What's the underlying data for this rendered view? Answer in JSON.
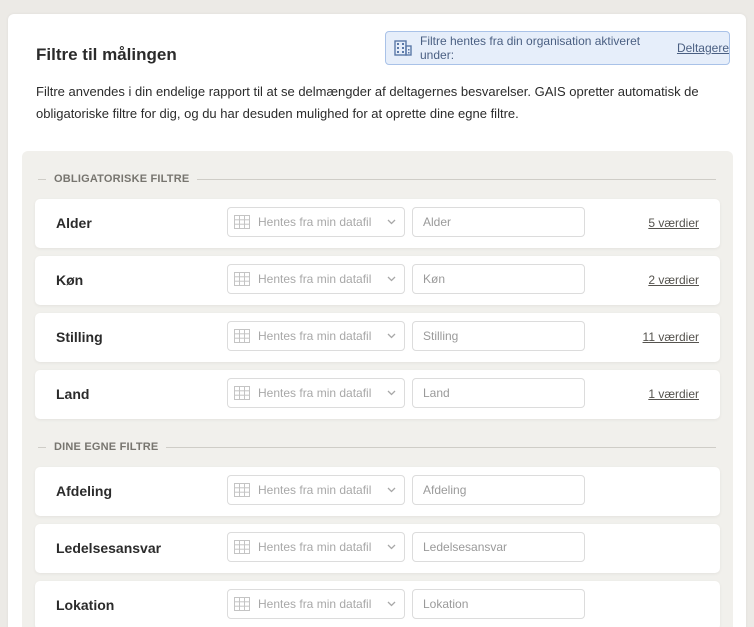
{
  "title": "Filtre til målingen",
  "info": {
    "text": "Filtre hentes fra din organisation aktiveret under:",
    "link": "Deltagere"
  },
  "description": "Filtre anvendes i din endelige rapport til at se delmængder af deltagernes besvarelser. GAIS opretter automatisk de obligatoriske filtre for dig, og du har desuden mulighed for at oprette dine egne filtre.",
  "sections": {
    "mandatory": {
      "header": "OBLIGATORISKE FILTRE",
      "rows": [
        {
          "label": "Alder",
          "select": "Hentes fra min datafil",
          "placeholder": "Alder",
          "values": "5 værdier"
        },
        {
          "label": "Køn",
          "select": "Hentes fra min datafil",
          "placeholder": "Køn",
          "values": "2 værdier"
        },
        {
          "label": "Stilling",
          "select": "Hentes fra min datafil",
          "placeholder": "Stilling",
          "values": "11 værdier"
        },
        {
          "label": "Land",
          "select": "Hentes fra min datafil",
          "placeholder": "Land",
          "values": "1 værdier"
        }
      ]
    },
    "custom": {
      "header": "DINE EGNE FILTRE",
      "rows": [
        {
          "label": "Afdeling",
          "select": "Hentes fra min datafil",
          "placeholder": "Afdeling"
        },
        {
          "label": "Ledelsesansvar",
          "select": "Hentes fra min datafil",
          "placeholder": "Ledelsesansvar"
        },
        {
          "label": "Lokation",
          "select": "Hentes fra min datafil",
          "placeholder": "Lokation"
        }
      ]
    }
  },
  "icons": {
    "info": "building-icon",
    "select": "table-grid-icon",
    "dropdown": "chevron-down-icon"
  },
  "colors": {
    "info_bg": "#e6eefa",
    "info_border": "#a9c2e8",
    "panel_bg": "#f1f0ec"
  }
}
